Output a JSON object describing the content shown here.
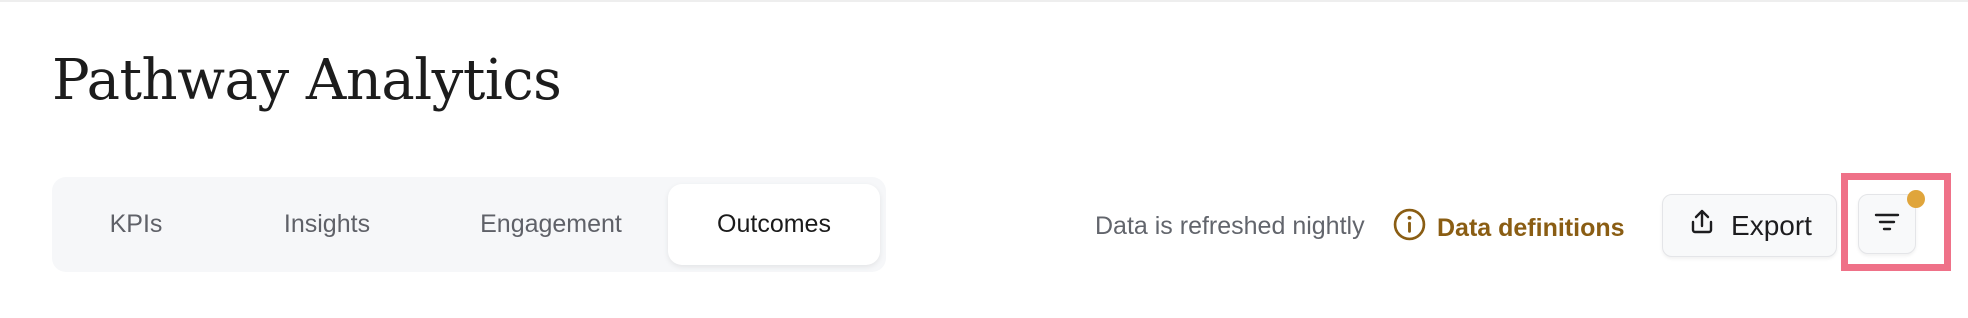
{
  "page": {
    "title": "Pathway Analytics"
  },
  "tabs": [
    {
      "label": "KPIs",
      "active": false
    },
    {
      "label": "Insights",
      "active": false
    },
    {
      "label": "Engagement",
      "active": false
    },
    {
      "label": "Outcomes",
      "active": true
    }
  ],
  "toolbar": {
    "refresh_note": "Data is refreshed nightly",
    "definitions_label": "Data definitions",
    "definitions_icon": "info-icon",
    "export_label": "Export",
    "export_icon": "upload-icon",
    "filter_icon": "filter-lines-icon",
    "filter_active_indicator": true
  },
  "colors": {
    "link": "#8a5d13",
    "filter_dot": "#e0a53b",
    "highlight": "#ef7188"
  }
}
